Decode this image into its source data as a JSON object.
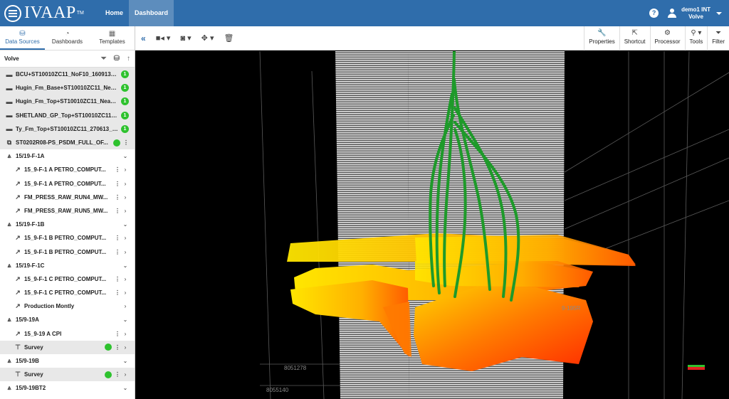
{
  "app": {
    "name": "IVAAP",
    "tm": "TM"
  },
  "nav": {
    "home": "Home",
    "dashboard": "Dashboard"
  },
  "user": {
    "help": "?",
    "name": "demo1 INT",
    "project": "Volve"
  },
  "sidebar": {
    "tabs": [
      {
        "label": "Data Sources",
        "icon": "database-icon"
      },
      {
        "label": "Dashboards",
        "icon": "gauge-icon"
      },
      {
        "label": "Templates",
        "icon": "grid-icon"
      }
    ],
    "header": "Volve",
    "rows": [
      {
        "label": "BCU+ST10010ZC11_NoF10_160913_...",
        "icon": "surface-icon",
        "count": "1",
        "level": 0,
        "shade": true
      },
      {
        "label": "Hugin_Fm_Base+ST10010ZC11_Near...",
        "icon": "surface-icon",
        "count": "1",
        "level": 0,
        "shade": true
      },
      {
        "label": "Hugin_Fm_Top+ST10010ZC11_Near_...",
        "icon": "surface-icon",
        "count": "1",
        "level": 0,
        "shade": true
      },
      {
        "label": "SHETLAND_GP_Top+ST10010ZC11_...",
        "icon": "surface-icon",
        "count": "1",
        "level": 0,
        "shade": true
      },
      {
        "label": "Ty_Fm_Top+ST10010ZC11_270613_u...",
        "icon": "surface-icon",
        "count": "1",
        "level": 0,
        "shade": true
      },
      {
        "label": "ST0202R08-PS_PSDM_FULL_OF...",
        "icon": "seismic-icon",
        "dot": true,
        "kebab": true,
        "level": 0,
        "shade": true
      },
      {
        "label": "15/19-F-1A",
        "icon": "rig-icon",
        "chev": "⌄",
        "level": 0
      },
      {
        "label": "15_9-F-1 A PETRO_COMPUT...",
        "icon": "log-icon",
        "kebab": true,
        "chev": "›",
        "level": 1
      },
      {
        "label": "15_9-F-1 A PETRO_COMPUT...",
        "icon": "log-icon",
        "kebab": true,
        "chev": "›",
        "level": 1
      },
      {
        "label": "FM_PRESS_RAW_RUN4_MW...",
        "icon": "log-icon",
        "kebab": true,
        "chev": "›",
        "level": 1
      },
      {
        "label": "FM_PRESS_RAW_RUN5_MW...",
        "icon": "log-icon",
        "kebab": true,
        "chev": "›",
        "level": 1
      },
      {
        "label": "15/19-F-1B",
        "icon": "rig-icon",
        "chev": "⌄",
        "level": 0
      },
      {
        "label": "15_9-F-1 B PETRO_COMPUT...",
        "icon": "log-icon",
        "kebab": true,
        "chev": "›",
        "level": 1
      },
      {
        "label": "15_9-F-1 B PETRO_COMPUT...",
        "icon": "log-icon",
        "kebab": true,
        "chev": "›",
        "level": 1
      },
      {
        "label": "15/19-F-1C",
        "icon": "rig-icon",
        "chev": "⌄",
        "level": 0
      },
      {
        "label": "15_9-F-1 C PETRO_COMPUT...",
        "icon": "log-icon",
        "kebab": true,
        "chev": "›",
        "level": 1
      },
      {
        "label": "15_9-F-1 C PETRO_COMPUT...",
        "icon": "log-icon",
        "kebab": true,
        "chev": "›",
        "level": 1
      },
      {
        "label": "Production Montly",
        "icon": "log-icon",
        "chev": "›",
        "level": 1
      },
      {
        "label": "15/9-19A",
        "icon": "rig-icon",
        "chev": "⌄",
        "level": 0
      },
      {
        "label": "15_9-19 A CPI",
        "icon": "log-icon",
        "kebab": true,
        "chev": "›",
        "level": 1
      },
      {
        "label": "Survey",
        "icon": "survey-icon",
        "dot": true,
        "kebab": true,
        "chev": "›",
        "level": 1,
        "shade": true
      },
      {
        "label": "15/9-19B",
        "icon": "rig-icon",
        "chev": "⌄",
        "level": 0
      },
      {
        "label": "Survey",
        "icon": "survey-icon",
        "dot": true,
        "kebab": true,
        "chev": "›",
        "level": 1,
        "shade": true
      },
      {
        "label": "15/9-19BT2",
        "icon": "rig-icon",
        "chev": "⌄",
        "level": 0
      }
    ]
  },
  "toolbar": {
    "right": [
      {
        "label": "Properties",
        "icon": "wrench-icon"
      },
      {
        "label": "Shortcut",
        "icon": "shortcut-icon"
      },
      {
        "label": "Processor",
        "icon": "processor-icon"
      },
      {
        "label": "Tools",
        "icon": "tools-icon"
      },
      {
        "label": "Filter",
        "icon": "filter-icon"
      }
    ]
  },
  "viewport": {
    "labels": {
      "a": "8051278",
      "b": "8055140",
      "c": "9-195R"
    }
  }
}
